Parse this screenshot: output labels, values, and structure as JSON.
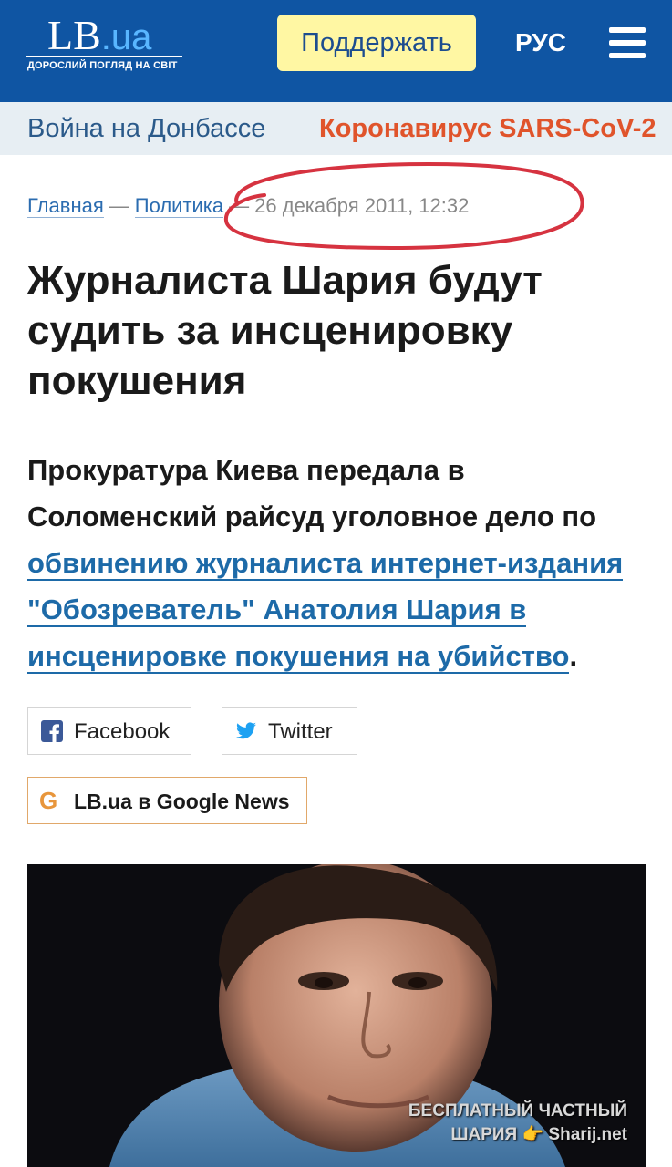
{
  "header": {
    "logo_main": "LB",
    "logo_tld": ".ua",
    "logo_tagline": "ДОРОСЛИЙ ПОГЛЯД НА СВІТ",
    "support_label": "Поддержать",
    "lang_label": "РУС",
    "menu_icon": "hamburger-icon",
    "bg_color": "#0f55a3"
  },
  "topics": [
    {
      "label": "Война на Донбассе"
    },
    {
      "label": "Коронавирус SARS-CoV-2"
    }
  ],
  "breadcrumb": {
    "home": "Главная",
    "section": "Политика",
    "date": "26 декабря 2011, 12:32"
  },
  "article": {
    "title": "Журналиста Шария будут судить за инсценировку покушения",
    "lead_text": "Прокуратура Киева передала в Соломенский райсуд уголовное дело по",
    "lead_link": "обвинению журналиста интернет-издания \"Обозреватель\" Анатолия Шария в инсценировке покушения на убийство",
    "lead_end": "."
  },
  "share": {
    "facebook_label": "Facebook",
    "twitter_label": "Twitter",
    "gnews_letter": "G",
    "gnews_label": "LB.ua в Google News"
  },
  "photo": {
    "watermark_line1": "БЕСПЛАТНЫЙ ЧАСТНЫЙ",
    "watermark_line2": "ШАРИЯ 👉 Sharij.net"
  }
}
